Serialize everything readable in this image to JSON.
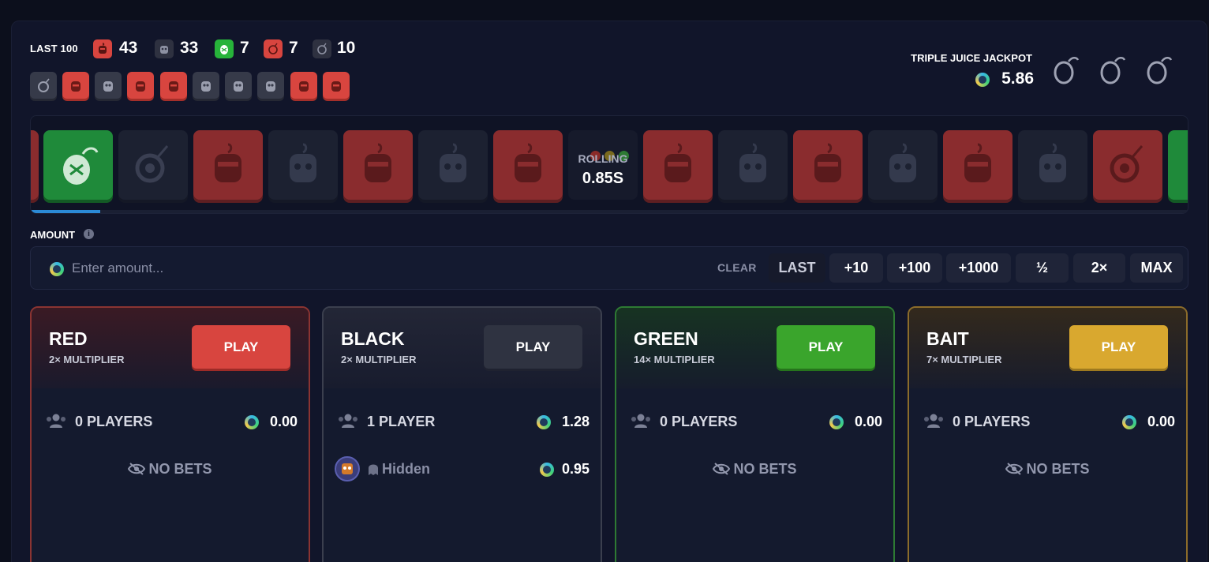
{
  "header": {
    "last100_label": "LAST 100",
    "counts": [
      {
        "type": "red",
        "value": "43"
      },
      {
        "type": "black",
        "value": "33"
      },
      {
        "type": "green",
        "value": "7"
      },
      {
        "type": "bait",
        "value": "7"
      },
      {
        "type": "bait-dark",
        "value": "10"
      }
    ],
    "recent": [
      "bait-dark",
      "red",
      "black",
      "red",
      "red",
      "black",
      "black",
      "black",
      "red",
      "red"
    ]
  },
  "jackpot": {
    "label": "TRIPLE JUICE JACKPOT",
    "value": "5.86",
    "icons": [
      "juice-icon",
      "juice-icon",
      "juice-icon"
    ]
  },
  "roller": {
    "status": "ROLLING",
    "time": "0.85S",
    "tiles": [
      "red",
      "green",
      "bait-dark",
      "red",
      "black",
      "red",
      "black",
      "red",
      "center",
      "red",
      "black",
      "red",
      "black",
      "red",
      "black",
      "bait-red",
      "green"
    ],
    "progress": 0.06
  },
  "amount": {
    "label": "AMOUNT",
    "placeholder": "Enter amount...",
    "clear": "CLEAR",
    "chips": [
      "LAST",
      "+10",
      "+100",
      "+1000",
      "½",
      "2×",
      "MAX"
    ]
  },
  "cards": [
    {
      "title": "RED",
      "sub": "2× MULTIPLIER",
      "play": "PLAY",
      "players": "0 PLAYERS",
      "total": "0.00",
      "nobets": "NO BETS",
      "color": "#d8453f"
    },
    {
      "title": "BLACK",
      "sub": "2× MULTIPLIER",
      "play": "PLAY",
      "players": "1 PLAYER",
      "total": "1.28",
      "bet_user": "Hidden",
      "bet_amount": "0.95",
      "color": "#2f3341"
    },
    {
      "title": "GREEN",
      "sub": "14× MULTIPLIER",
      "play": "PLAY",
      "players": "0 PLAYERS",
      "total": "0.00",
      "nobets": "NO BETS",
      "color": "#3aa52c"
    },
    {
      "title": "BAIT",
      "sub": "7× MULTIPLIER",
      "play": "PLAY",
      "players": "0 PLAYERS",
      "total": "0.00",
      "nobets": "NO BETS",
      "color": "#d9a82f"
    }
  ]
}
